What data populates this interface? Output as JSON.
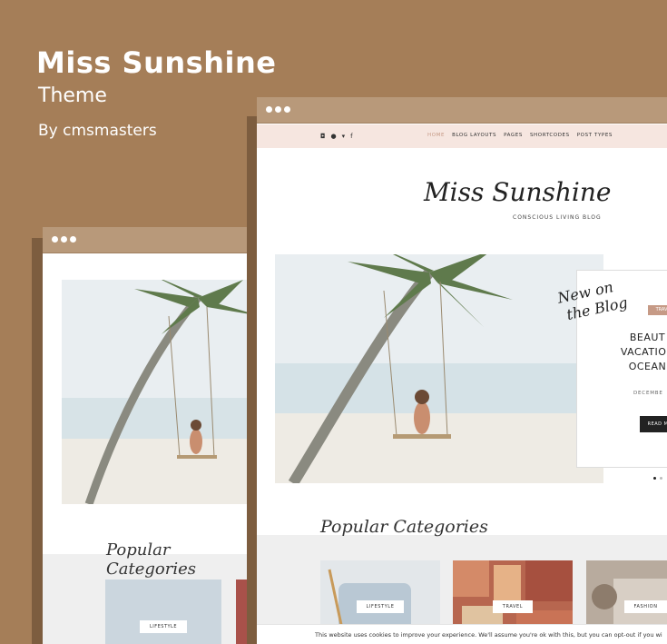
{
  "header": {
    "title": "Miss Sunshine",
    "subtitle": "Theme",
    "byline": "By cmsmasters"
  },
  "site": {
    "nav": [
      "HOME",
      "BLOG LAYOUTS",
      "PAGES",
      "SHORTCODES",
      "POST TYPES"
    ],
    "social_icons": [
      "instagram-icon",
      "pinterest-icon",
      "twitter-icon",
      "facebook-icon"
    ],
    "logo": "Miss Sunshine",
    "logo_sub": "CONSCIOUS LIVING BLOG",
    "new_on": [
      "New on",
      "the Blog"
    ],
    "featured": {
      "tag": "TRAV",
      "headline": [
        "BEAUT",
        "VACATION",
        "OCEAN"
      ],
      "date": "DECEMBE",
      "read_more": "READ M"
    },
    "popular_title": "Popular Categories",
    "categories": [
      "LIFESTYLE",
      "TRAVEL",
      "FASHION"
    ],
    "cookie_text": "This website uses cookies to improve your experience. We'll assume you're ok with this, but you can opt-out if you wi"
  },
  "colors": {
    "background": "#a57e58",
    "window_bar": "#b8997a",
    "nav_bg": "#f6e6e0",
    "accent": "#c69a86"
  }
}
